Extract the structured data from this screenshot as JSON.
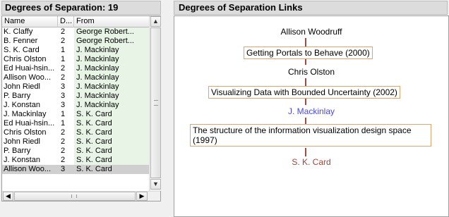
{
  "left_panel": {
    "title": "Degrees of Separation: 19",
    "columns": [
      "Name",
      "D...",
      "From"
    ],
    "rows": [
      {
        "name": "K. Claffy",
        "degree": "2",
        "from": "George Robert..."
      },
      {
        "name": "B. Fenner",
        "degree": "2",
        "from": "George Robert..."
      },
      {
        "name": "S. K. Card",
        "degree": "1",
        "from": "J. Mackinlay"
      },
      {
        "name": "Chris Olston",
        "degree": "1",
        "from": "J. Mackinlay"
      },
      {
        "name": "Ed Huai-hsin...",
        "degree": "2",
        "from": "J. Mackinlay"
      },
      {
        "name": "Allison Woo...",
        "degree": "2",
        "from": "J. Mackinlay"
      },
      {
        "name": "John Riedl",
        "degree": "3",
        "from": "J. Mackinlay"
      },
      {
        "name": "P. Barry",
        "degree": "3",
        "from": "J. Mackinlay"
      },
      {
        "name": "J. Konstan",
        "degree": "3",
        "from": "J. Mackinlay"
      },
      {
        "name": "J. Mackinlay",
        "degree": "1",
        "from": "S. K. Card"
      },
      {
        "name": "Ed Huai-hsin...",
        "degree": "1",
        "from": "S. K. Card"
      },
      {
        "name": "Chris Olston",
        "degree": "2",
        "from": "S. K. Card"
      },
      {
        "name": "John Riedl",
        "degree": "2",
        "from": "S. K. Card"
      },
      {
        "name": "P. Barry",
        "degree": "2",
        "from": "S. K. Card"
      },
      {
        "name": "J. Konstan",
        "degree": "2",
        "from": "S. K. Card"
      },
      {
        "name": "Allison Woo...",
        "degree": "3",
        "from": "S. K. Card"
      }
    ],
    "selected_row": 15,
    "scroll_icons": {
      "up": "▲",
      "down": "▼",
      "left": "◀",
      "right": "▶"
    }
  },
  "right_panel": {
    "title": "Degrees of Separation Links",
    "chain": {
      "person_1": "Allison Woodruff",
      "pub_1": "Getting Portals to Behave (2000)",
      "person_2": "Chris Olston",
      "pub_2": "Visualizing Data with Bounded Uncertainty (2002)",
      "person_3": "J. Mackinlay",
      "pub_3_line1": "The structure of the information visualization design space",
      "pub_3_line2": "(1997)",
      "person_4": "S. K. Card"
    }
  },
  "colors": {
    "highlight_person": "#4a4ae0",
    "target_person": "#a0443a",
    "pub_border": "#e0a470",
    "from_column_bg": "#e8f5e6"
  }
}
